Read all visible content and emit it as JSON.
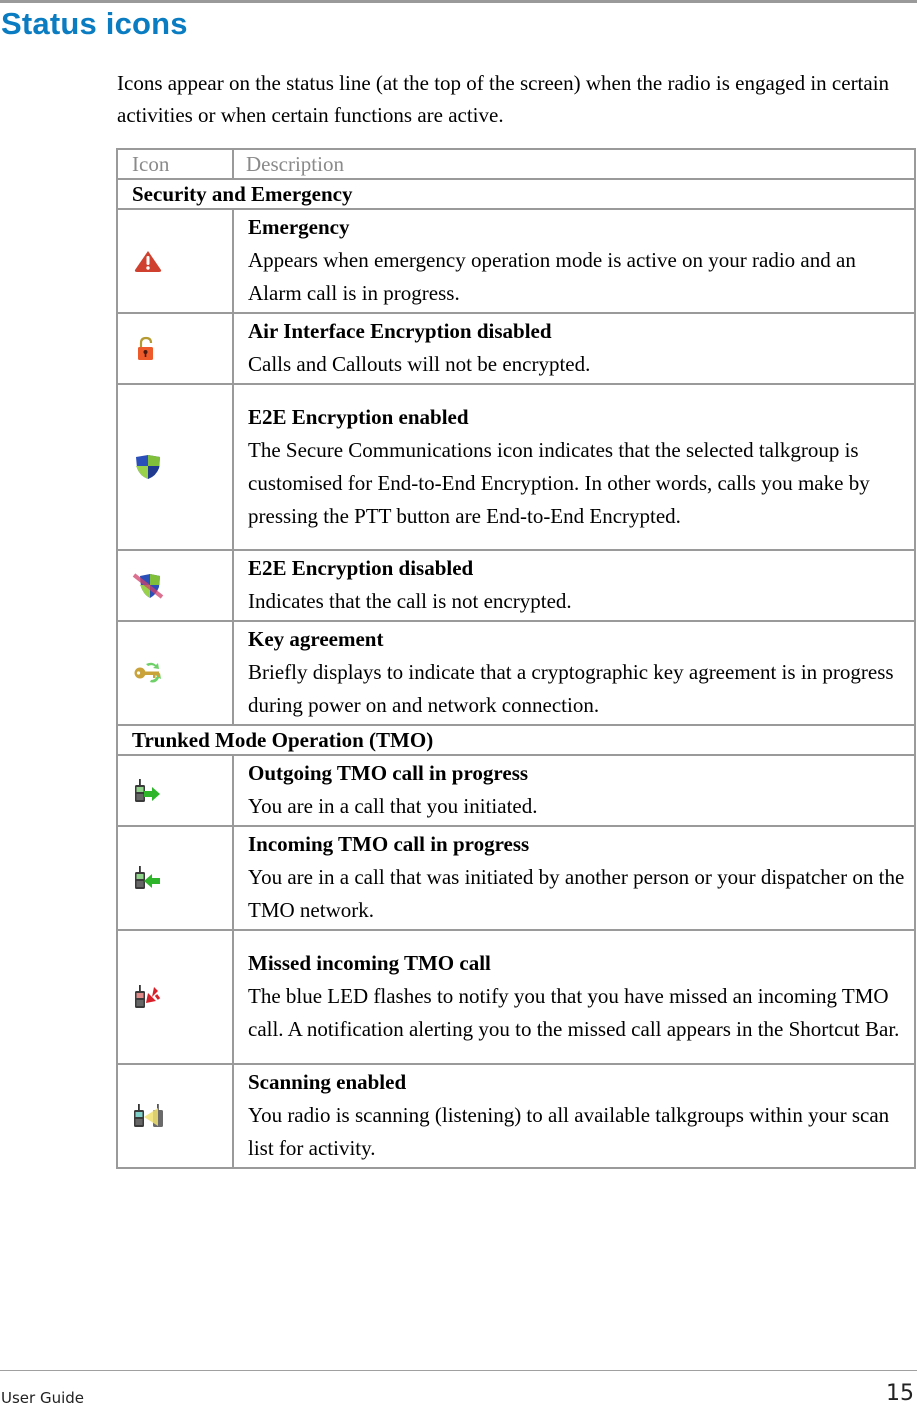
{
  "page": {
    "heading": "Status icons",
    "intro": "Icons appear on the status line (at the top of the screen) when the radio is engaged in certain activities or when certain functions are active."
  },
  "table": {
    "headers": {
      "icon": "Icon",
      "description": "Description"
    },
    "sections": [
      {
        "title": "Security and Emergency",
        "rows": [
          {
            "icon": "emergency-warning-icon",
            "title": "Emergency",
            "text": "Appears when emergency operation mode is active on your radio and an Alarm call is in progress."
          },
          {
            "icon": "unlocked-padlock-icon",
            "title": "Air Interface Encryption disabled",
            "text": "Calls and Callouts will not be encrypted."
          },
          {
            "icon": "shield-icon",
            "title": "E2E Encryption enabled",
            "text": "The Secure Communications icon indicates that the selected talkgroup is customised for End-to-End Encryption. In other words, calls you make by pressing the PTT button are End-to-End Encrypted."
          },
          {
            "icon": "shield-crossed-icon",
            "title": "E2E Encryption disabled",
            "text": "Indicates that the call is not encrypted."
          },
          {
            "icon": "key-exchange-icon",
            "title": "Key agreement",
            "text": "Briefly displays to indicate that a cryptographic key agreement is in progress during power on and network connection."
          }
        ]
      },
      {
        "title": "Trunked Mode Operation (TMO)",
        "rows": [
          {
            "icon": "radio-outgoing-arrow-icon",
            "title": "Outgoing TMO call in progress",
            "text": "You are in a call that you initiated."
          },
          {
            "icon": "radio-incoming-arrow-icon",
            "title": "Incoming TMO call in progress",
            "text": "You are in a call that was initiated by another person or your dispatcher on the TMO network."
          },
          {
            "icon": "radio-missed-call-icon",
            "title": "Missed incoming TMO call",
            "text": "The blue LED flashes to notify you that you have missed an incoming TMO call. A notification alerting you to the missed call appears in the Shortcut Bar."
          },
          {
            "icon": "radio-scanning-icon",
            "title": "Scanning enabled",
            "text": "You radio is scanning (listening) to all available talkgroups within your scan list for activity."
          }
        ]
      }
    ]
  },
  "footer": {
    "label": "User Guide",
    "page_number": "15"
  },
  "colors": {
    "heading": "#0a7cc1",
    "rule": "#9a9a9a",
    "header_text": "#8a8a8a"
  }
}
